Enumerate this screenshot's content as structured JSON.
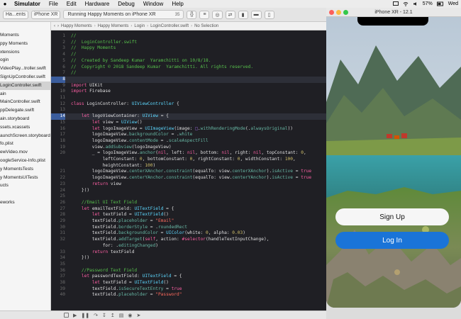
{
  "menubar": {
    "items": [
      "Simulator",
      "File",
      "Edit",
      "Hardware",
      "Debug",
      "Window",
      "Help"
    ],
    "battery": "57%",
    "clock": "Wed"
  },
  "toolbar": {
    "scheme": "Ha...ents",
    "device": "iPhone XR",
    "status": "Running Happy Moments on iPhone XR",
    "count": "35"
  },
  "jumpbar": [
    "Happy Moments",
    "Happy Moments",
    "Login",
    "LoginController.swift",
    "No Selection"
  ],
  "navigator": {
    "items": [
      "Moments",
      "ppy Moments",
      "xtensions",
      "ogin",
      "VideoPlay...troller.swift",
      "SignUpController.swift",
      "LoginController.swift",
      "ain",
      "MainController.swift",
      "ppDelegate.swift",
      "ain.storyboard",
      "ssets.xcassets",
      "aunchScreen.storyboard",
      "fo.plist",
      "ewVideo.mov",
      "oogleService-Info.plist",
      "y MomentsTests",
      "y MomentsUITests",
      "ucts",
      "",
      "eworks"
    ],
    "selected_index": 6
  },
  "code": {
    "lines": [
      {
        "n": "1",
        "segs": [
          [
            "com",
            "//"
          ]
        ]
      },
      {
        "n": "2",
        "segs": [
          [
            "com",
            "//  LoginController.swift"
          ]
        ]
      },
      {
        "n": "3",
        "segs": [
          [
            "com",
            "//  Happy Moments"
          ]
        ]
      },
      {
        "n": "4",
        "segs": [
          [
            "com",
            "//"
          ]
        ]
      },
      {
        "n": "5",
        "segs": [
          [
            "com",
            "//  Created by Sandeep Kumar  Yaramchitti on 10/8/18."
          ]
        ]
      },
      {
        "n": "6",
        "segs": [
          [
            "com",
            "//  Copyright © 2018 Sandeep Kumar  Yaramchitti. All rights reserved."
          ]
        ]
      },
      {
        "n": "7",
        "segs": [
          [
            "com",
            "//"
          ]
        ]
      },
      {
        "n": "8",
        "segs": [],
        "hl": true
      },
      {
        "n": "9",
        "segs": [
          [
            "kw",
            "import"
          ],
          [
            "pl",
            " UIKit"
          ]
        ]
      },
      {
        "n": "10",
        "segs": [
          [
            "kw",
            "import"
          ],
          [
            "pl",
            " Firebase"
          ]
        ]
      },
      {
        "n": "11",
        "segs": []
      },
      {
        "n": "12",
        "segs": [
          [
            "kw",
            "class"
          ],
          [
            "pl",
            " LoginController: "
          ],
          [
            "ty",
            "UIViewController"
          ],
          [
            "pl",
            " {"
          ]
        ]
      },
      {
        "n": "13",
        "segs": []
      },
      {
        "n": "14",
        "segs": [
          [
            "pl",
            "    "
          ],
          [
            "kw",
            "let"
          ],
          [
            "pl",
            " logoViewContainer: "
          ],
          [
            "ty",
            "UIView"
          ],
          [
            "pl",
            " = {"
          ]
        ],
        "hl": true
      },
      {
        "n": "15",
        "segs": [
          [
            "pl",
            "        "
          ],
          [
            "kw",
            "let"
          ],
          [
            "pl",
            " view = "
          ],
          [
            "ty",
            "UIView"
          ],
          [
            "pl",
            "()"
          ]
        ]
      },
      {
        "n": "16",
        "segs": [
          [
            "pl",
            "        "
          ],
          [
            "kw",
            "let"
          ],
          [
            "pl",
            " logoImageView = "
          ],
          [
            "ty",
            "UIImageView"
          ],
          [
            "pl",
            "(image: "
          ],
          [
            "pr",
            "□"
          ],
          [
            "pl",
            "."
          ],
          [
            "fn",
            "withRenderingMode"
          ],
          [
            "pl",
            "(."
          ],
          [
            "fn",
            "alwaysOriginal"
          ],
          [
            "pl",
            "))"
          ]
        ]
      },
      {
        "n": "17",
        "segs": [
          [
            "pl",
            "        logoImageView."
          ],
          [
            "fn",
            "backgroundColor"
          ],
          [
            "pl",
            " = ."
          ],
          [
            "fn",
            "white"
          ]
        ]
      },
      {
        "n": "18",
        "segs": [
          [
            "pl",
            "        logoImageView."
          ],
          [
            "fn",
            "contentMode"
          ],
          [
            "pl",
            " = ."
          ],
          [
            "fn",
            "scaleAspectFill"
          ]
        ]
      },
      {
        "n": "19",
        "segs": [
          [
            "pl",
            "        view."
          ],
          [
            "fn",
            "addSubview"
          ],
          [
            "pl",
            "(logoImageView)"
          ]
        ]
      },
      {
        "n": "20",
        "segs": [
          [
            "pl",
            "        _ = logoImageView."
          ],
          [
            "fn",
            "anchor"
          ],
          [
            "pl",
            "("
          ],
          [
            "kw",
            "nil"
          ],
          [
            "pl",
            ", left: "
          ],
          [
            "kw",
            "nil"
          ],
          [
            "pl",
            ", bottom: "
          ],
          [
            "kw",
            "nil"
          ],
          [
            "pl",
            ", right: "
          ],
          [
            "kw",
            "nil"
          ],
          [
            "pl",
            ", topConstant: "
          ],
          [
            "num",
            "0"
          ],
          [
            "pl",
            ","
          ]
        ]
      },
      {
        "n": "",
        "segs": [
          [
            "pl",
            "            leftConstant: "
          ],
          [
            "num",
            "0"
          ],
          [
            "pl",
            ", bottomConstant: "
          ],
          [
            "num",
            "0"
          ],
          [
            "pl",
            ", rightConstant: "
          ],
          [
            "num",
            "0"
          ],
          [
            "pl",
            ", widthConstant: "
          ],
          [
            "num",
            "100"
          ],
          [
            "pl",
            ","
          ]
        ]
      },
      {
        "n": "",
        "segs": [
          [
            "pl",
            "            heightConstant: "
          ],
          [
            "num",
            "100"
          ],
          [
            "pl",
            ")"
          ]
        ]
      },
      {
        "n": "21",
        "segs": [
          [
            "pl",
            "        logoImageView."
          ],
          [
            "fn",
            "centerXAnchor"
          ],
          [
            "pl",
            "."
          ],
          [
            "fn",
            "constraint"
          ],
          [
            "pl",
            "(equalTo: view."
          ],
          [
            "fn",
            "centerXAnchor"
          ],
          [
            "pl",
            ")."
          ],
          [
            "fn",
            "isActive"
          ],
          [
            "pl",
            " = "
          ],
          [
            "kw",
            "true"
          ]
        ]
      },
      {
        "n": "22",
        "segs": [
          [
            "pl",
            "        logoImageView."
          ],
          [
            "fn",
            "centerYAnchor"
          ],
          [
            "pl",
            "."
          ],
          [
            "fn",
            "constraint"
          ],
          [
            "pl",
            "(equalTo: view."
          ],
          [
            "fn",
            "centerYAnchor"
          ],
          [
            "pl",
            ")."
          ],
          [
            "fn",
            "isActive"
          ],
          [
            "pl",
            " = "
          ],
          [
            "kw",
            "true"
          ]
        ]
      },
      {
        "n": "23",
        "segs": [
          [
            "pl",
            "        "
          ],
          [
            "kw",
            "return"
          ],
          [
            "pl",
            " view"
          ]
        ]
      },
      {
        "n": "24",
        "segs": [
          [
            "pl",
            "    }()"
          ]
        ]
      },
      {
        "n": "25",
        "segs": []
      },
      {
        "n": "26",
        "segs": [
          [
            "pl",
            "    "
          ],
          [
            "com",
            "//Email UI Text Field"
          ]
        ]
      },
      {
        "n": "27",
        "segs": [
          [
            "pl",
            "    "
          ],
          [
            "kw",
            "let"
          ],
          [
            "pl",
            " emailTextField: "
          ],
          [
            "ty",
            "UITextField"
          ],
          [
            "pl",
            " = {"
          ]
        ]
      },
      {
        "n": "28",
        "segs": [
          [
            "pl",
            "        "
          ],
          [
            "kw",
            "let"
          ],
          [
            "pl",
            " textField = "
          ],
          [
            "ty",
            "UITextField"
          ],
          [
            "pl",
            "()"
          ]
        ]
      },
      {
        "n": "29",
        "segs": [
          [
            "pl",
            "        textField."
          ],
          [
            "fn",
            "placeholder"
          ],
          [
            "pl",
            " = "
          ],
          [
            "str",
            "\"Email\""
          ]
        ]
      },
      {
        "n": "30",
        "segs": [
          [
            "pl",
            "        textField."
          ],
          [
            "fn",
            "borderStyle"
          ],
          [
            "pl",
            " = ."
          ],
          [
            "fn",
            "roundedRect"
          ]
        ]
      },
      {
        "n": "31",
        "segs": [
          [
            "pl",
            "        textField."
          ],
          [
            "fn",
            "backgroundColor"
          ],
          [
            "pl",
            " = "
          ],
          [
            "ty",
            "UIColor"
          ],
          [
            "pl",
            "(white: "
          ],
          [
            "num",
            "0"
          ],
          [
            "pl",
            ", alpha: "
          ],
          [
            "num",
            "0.03"
          ],
          [
            "pl",
            ")"
          ]
        ]
      },
      {
        "n": "32",
        "segs": [
          [
            "pl",
            "        textField."
          ],
          [
            "fn",
            "addTarget"
          ],
          [
            "pl",
            "("
          ],
          [
            "kw",
            "self"
          ],
          [
            "pl",
            ", action: "
          ],
          [
            "kw",
            "#selector"
          ],
          [
            "pl",
            "(handleTextInputChange),"
          ]
        ]
      },
      {
        "n": "",
        "segs": [
          [
            "pl",
            "            for: ."
          ],
          [
            "fn",
            "editingChanged"
          ],
          [
            "pl",
            ")"
          ]
        ]
      },
      {
        "n": "33",
        "segs": [
          [
            "pl",
            "        "
          ],
          [
            "kw",
            "return"
          ],
          [
            "pl",
            " textField"
          ]
        ]
      },
      {
        "n": "34",
        "segs": [
          [
            "pl",
            "    }()"
          ]
        ]
      },
      {
        "n": "35",
        "segs": []
      },
      {
        "n": "36",
        "segs": [
          [
            "pl",
            "    "
          ],
          [
            "com",
            "//Password Text Field"
          ]
        ]
      },
      {
        "n": "37",
        "segs": [
          [
            "pl",
            "    "
          ],
          [
            "kw",
            "let"
          ],
          [
            "pl",
            " passwordTextField: "
          ],
          [
            "ty",
            "UITextField"
          ],
          [
            "pl",
            " = {"
          ]
        ]
      },
      {
        "n": "38",
        "segs": [
          [
            "pl",
            "        "
          ],
          [
            "kw",
            "let"
          ],
          [
            "pl",
            " textField = "
          ],
          [
            "ty",
            "UITextField"
          ],
          [
            "pl",
            "()"
          ]
        ]
      },
      {
        "n": "39",
        "segs": [
          [
            "pl",
            "        textField."
          ],
          [
            "fn",
            "isSecureTextEntry"
          ],
          [
            "pl",
            " = "
          ],
          [
            "kw",
            "true"
          ]
        ]
      },
      {
        "n": "40",
        "segs": [
          [
            "pl",
            "        textField."
          ],
          [
            "fn",
            "placeholder"
          ],
          [
            "pl",
            " = "
          ],
          [
            "str",
            "\"Password\""
          ]
        ]
      }
    ]
  },
  "simulator": {
    "title": "iPhone XR - 12.1",
    "signup_label": "Sign Up",
    "login_label": "Log In"
  },
  "colors": {
    "accent": "#1a74d8",
    "editor_bg": "#1f1f24"
  }
}
